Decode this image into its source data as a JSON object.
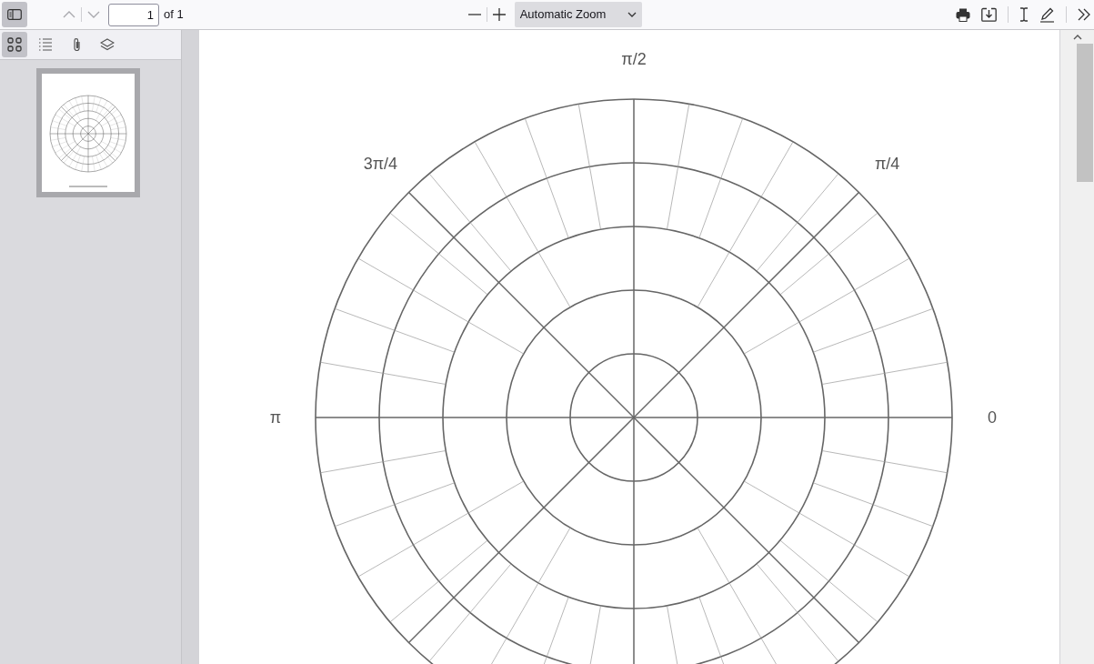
{
  "toolbar": {
    "sidebar_toggle": {
      "selected": true
    },
    "previous_page": {
      "disabled": true
    },
    "next_page": {
      "disabled": true
    },
    "page_number": "1",
    "page_count": "of 1",
    "zoom": "Automatic Zoom"
  },
  "sidebar": {
    "tabs": [
      {
        "kind": "thumbnails",
        "selected": true
      },
      {
        "kind": "outline",
        "selected": false
      },
      {
        "kind": "attachments",
        "selected": false
      },
      {
        "kind": "layers",
        "selected": false
      }
    ],
    "thumbnails": [
      {
        "selected": true
      }
    ]
  },
  "document": {
    "angle_labels": [
      "0",
      "π/4",
      "π/2",
      "3π/4",
      "π"
    ]
  }
}
